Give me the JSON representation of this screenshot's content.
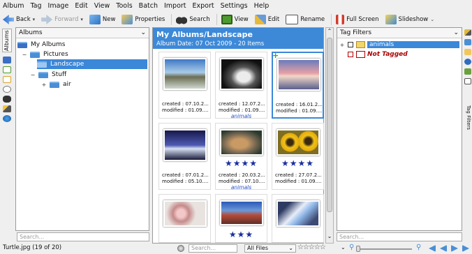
{
  "menubar": [
    "Album",
    "Tag",
    "Image",
    "Edit",
    "View",
    "Tools",
    "Batch",
    "Import",
    "Export",
    "Settings",
    "Help"
  ],
  "toolbar": {
    "back": "Back",
    "forward": "Forward",
    "new": "New",
    "properties": "Properties",
    "search": "Search",
    "view": "View",
    "edit": "Edit",
    "rename": "Rename",
    "fullscreen": "Full Screen",
    "slideshow": "Slideshow"
  },
  "left_tabs": {
    "albums": "Albums"
  },
  "albums_panel": {
    "header": "Albums",
    "tree": [
      "My Albums",
      "Pictures",
      "Landscape",
      "Stuff",
      "air"
    ],
    "search_placeholder": "Search..."
  },
  "main": {
    "title": "My Albums/Landscape",
    "subtitle": "Album Date: 07 Oct 2009 - 20 Items",
    "thumbnails": [
      {
        "created": "created : 07.10.2...",
        "modified": "modified : 01.09....",
        "stars": "",
        "tag": ""
      },
      {
        "created": "created : 12.07.2...",
        "modified": "modified : 01.09....",
        "stars": "",
        "tag": "animals"
      },
      {
        "created": "created : 16.01.2...",
        "modified": "modified : 01.09....",
        "stars": "",
        "tag": ""
      },
      {
        "created": "created : 07.01.2...",
        "modified": "modified : 05.10....",
        "stars": "",
        "tag": ""
      },
      {
        "created": "created : 20.03.2...",
        "modified": "modified : 07.10....",
        "stars": "★★★★",
        "tag": "animals"
      },
      {
        "created": "created : 27.07.2...",
        "modified": "modified : 01.09....",
        "stars": "★★★★",
        "tag": ""
      },
      {
        "created": "",
        "modified": "",
        "stars": "",
        "tag": ""
      },
      {
        "created": "",
        "modified": "",
        "stars": "★★★",
        "tag": ""
      },
      {
        "created": "",
        "modified": "",
        "stars": "",
        "tag": ""
      }
    ]
  },
  "tag_filters": {
    "header": "Tag Filters",
    "items": [
      "animals",
      "Not Tagged"
    ],
    "search_placeholder": "Search..."
  },
  "right_tabs": {
    "tag_filters": "Tag Filters"
  },
  "statusbar": {
    "text": "Turtle.jpg (19 of 20)",
    "search_placeholder": "Search...",
    "filter": "All Files",
    "rating_stars": "☆☆☆☆☆"
  },
  "colors": {
    "accent": "#3b87d8",
    "stars": "#1b2fa0",
    "tag": "#2750c8",
    "not_tagged": "#a00000"
  },
  "icons": [
    "back-arrow-icon",
    "forward-arrow-icon",
    "new-album-icon",
    "properties-icon",
    "binoculars-icon",
    "view-icon",
    "edit-icon",
    "rename-icon",
    "fullscreen-icon",
    "slideshow-icon"
  ]
}
